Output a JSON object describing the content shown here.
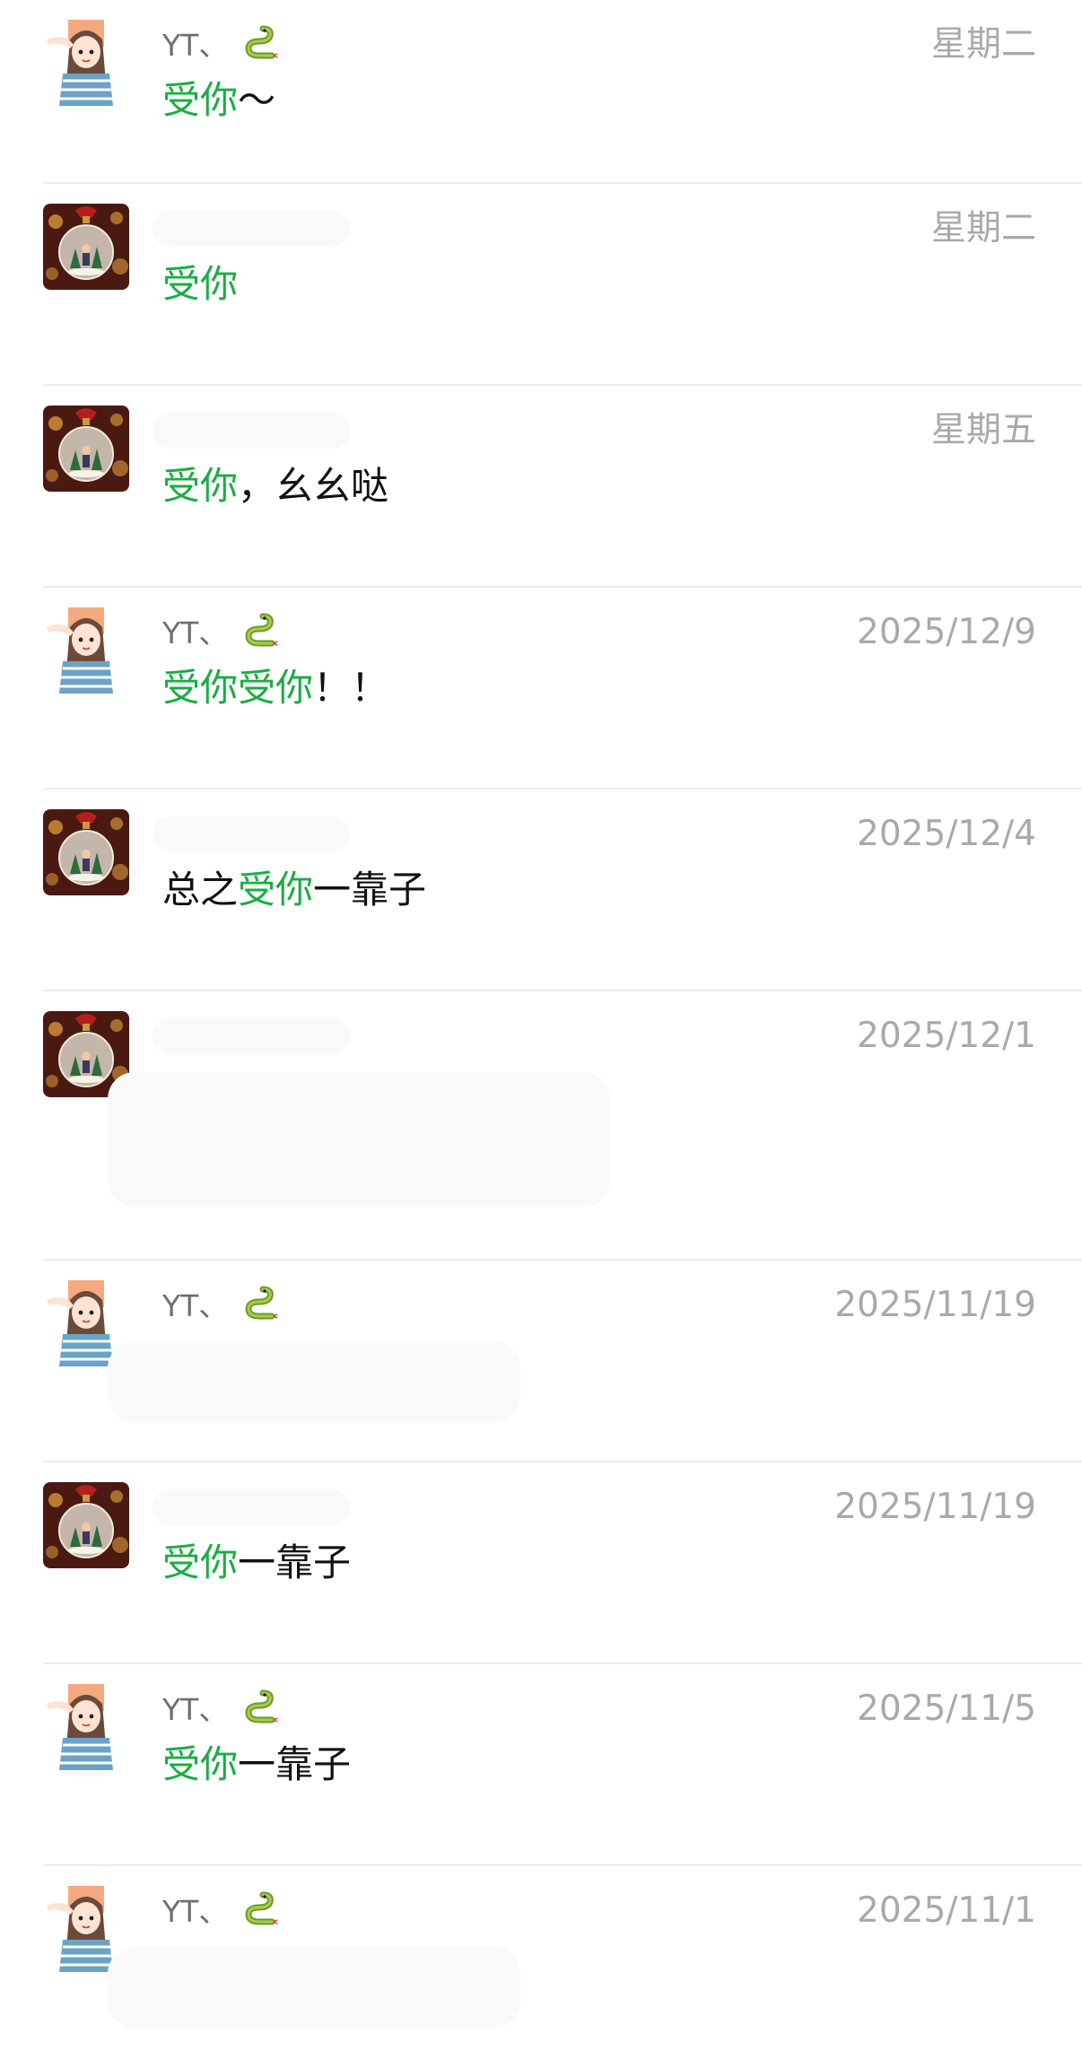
{
  "conversations": [
    {
      "name": "YT、",
      "has_snake": true,
      "date": "星期二",
      "segments": [
        {
          "t": "受你",
          "hl": true
        },
        {
          "t": "～",
          "hl": false
        }
      ],
      "avatar": "girl"
    },
    {
      "name": "",
      "has_snake": false,
      "date": "星期二",
      "segments": [
        {
          "t": "受你",
          "hl": true
        }
      ],
      "avatar": "ornament"
    },
    {
      "name": "",
      "has_snake": false,
      "date": "星期五",
      "segments": [
        {
          "t": "受你",
          "hl": true
        },
        {
          "t": "，幺幺哒",
          "hl": false
        }
      ],
      "avatar": "ornament"
    },
    {
      "name": "YT、",
      "has_snake": true,
      "date": "2025/12/9",
      "segments": [
        {
          "t": "受你受你",
          "hl": true
        },
        {
          "t": "！！",
          "hl": false
        }
      ],
      "avatar": "girl"
    },
    {
      "name": "",
      "has_snake": false,
      "date": "2025/12/4",
      "segments": [
        {
          "t": "总之",
          "hl": false
        },
        {
          "t": "受你",
          "hl": true
        },
        {
          "t": "一靠子",
          "hl": false
        }
      ],
      "avatar": "ornament"
    },
    {
      "name": "",
      "has_snake": false,
      "date": "2025/12/1",
      "segments": [],
      "avatar": "ornament"
    },
    {
      "name": "YT、",
      "has_snake": true,
      "date": "2025/11/19",
      "segments": [],
      "avatar": "girl"
    },
    {
      "name": "",
      "has_snake": false,
      "date": "2025/11/19",
      "segments": [
        {
          "t": "受你",
          "hl": true
        },
        {
          "t": "一靠子",
          "hl": false
        }
      ],
      "avatar": "ornament"
    },
    {
      "name": "YT、",
      "has_snake": true,
      "date": "2025/11/5",
      "segments": [
        {
          "t": "受你",
          "hl": true
        },
        {
          "t": "一靠子",
          "hl": false
        }
      ],
      "avatar": "girl"
    },
    {
      "name": "YT、",
      "has_snake": true,
      "date": "2025/11/1",
      "segments": [],
      "avatar": "girl"
    }
  ],
  "colors": {
    "highlight": "#1aad44",
    "date": "#a9a9a9",
    "name": "#6f6f6f",
    "divider": "#ebebeb"
  }
}
